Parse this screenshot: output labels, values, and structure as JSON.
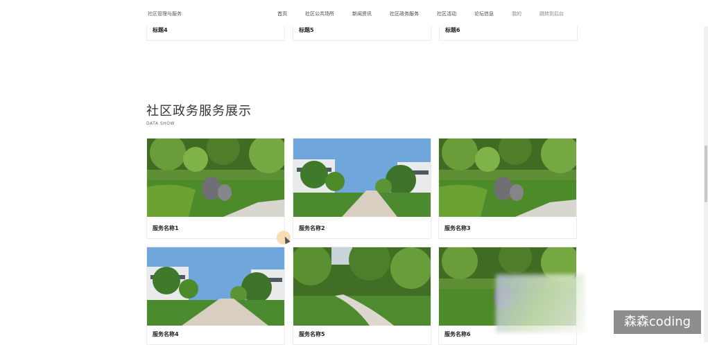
{
  "nav": {
    "brand": "社区管理与服务",
    "items": [
      "首页",
      "社区公共场所",
      "新闻资讯",
      "社区政务服务",
      "社区活动",
      "论坛信息",
      "我的",
      "跳转到后台"
    ]
  },
  "top_cards": [
    "标题4",
    "标题5",
    "标题6"
  ],
  "section": {
    "title": "社区政务服务展示",
    "subtitle": "DATA SHOW"
  },
  "services": [
    "服务名称1",
    "服务名称2",
    "服务名称3",
    "服务名称4",
    "服务名称5",
    "服务名称6"
  ],
  "watermark": "森森coding",
  "colors": {
    "sky": "#6fa6dc",
    "grass": "#4d8a2a",
    "path": "#d9cfc0"
  }
}
